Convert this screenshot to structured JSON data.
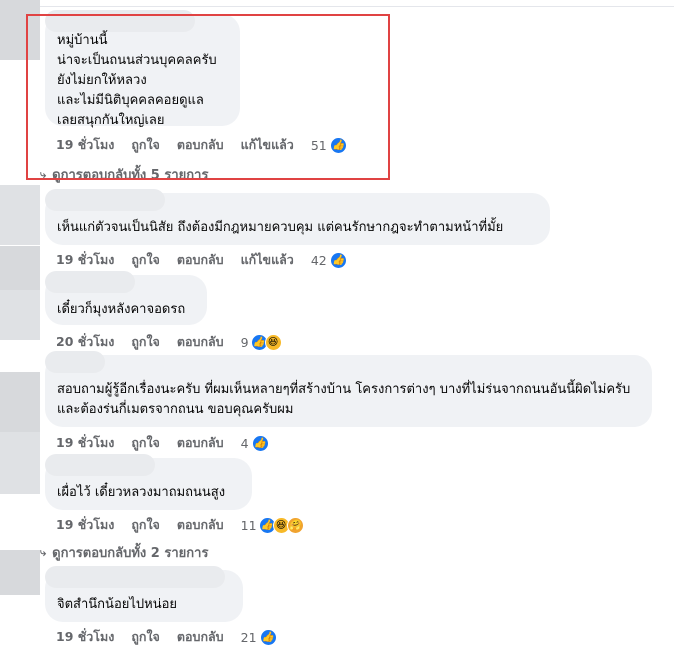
{
  "colors": {
    "like_blue": "#1877f2",
    "meta_gray": "#65676b",
    "bubble_bg": "#f0f2f5",
    "highlight_red": "#e04343"
  },
  "comments": [
    {
      "text": "หมู่บ้านนี้\nน่าจะเป็นถนนส่วนบุคคลครับ\nยังไม่ยกให้หลวง\nและไม่มีนิติบุคคลคอยดูแล\nเลยสนุกกันใหญ่เลย",
      "time": "19 ชั่วโมง",
      "like": "ถูกใจ",
      "reply": "ตอบกลับ",
      "edited": "แก้ไขแล้ว",
      "reaction_count": "51",
      "reactions": [
        "like-icon"
      ]
    },
    {
      "text": "เห็นแก่ตัวจนเป็นนิสัย ถึงต้องมีกฎหมายควบคุม แต่คนรักษากฎจะทำตามหน้าที่มั้ย",
      "time": "19 ชั่วโมง",
      "like": "ถูกใจ",
      "reply": "ตอบกลับ",
      "edited": "แก้ไขแล้ว",
      "reaction_count": "42",
      "reactions": [
        "like-icon"
      ]
    },
    {
      "text": "เดี๋ยวก็มุงหลังคาจอดรถ",
      "time": "20 ชั่วโมง",
      "like": "ถูกใจ",
      "reply": "ตอบกลับ",
      "reaction_count": "9",
      "reactions": [
        "like-icon",
        "haha-icon"
      ]
    },
    {
      "text": "สอบถามผู้รู้อีกเรื่องนะครับ ที่ผมเห็นหลายๆที่สร้างบ้าน โครงการต่างๆ บางที่ไม่ร่นจากถนนอันนี้ผิดไม่ครับ และต้องร่นกี่เมตรจากถนน ขอบคุณครับผม",
      "time": "19 ชั่วโมง",
      "like": "ถูกใจ",
      "reply": "ตอบกลับ",
      "reaction_count": "4",
      "reactions": [
        "like-icon"
      ]
    },
    {
      "text": "เผื่อไว้ เดี๋ยวหลวงมาถมถนนสูง",
      "time": "19 ชั่วโมง",
      "like": "ถูกใจ",
      "reply": "ตอบกลับ",
      "reaction_count": "11",
      "reactions": [
        "like-icon",
        "haha-icon",
        "care-icon"
      ]
    },
    {
      "text": "จิตสำนึกน้อยไปหน่อย",
      "time": "19 ชั่วโมง",
      "like": "ถูกใจ",
      "reply": "ตอบกลับ",
      "reaction_count": "21",
      "reactions": [
        "like-icon"
      ]
    }
  ],
  "view_replies": [
    {
      "label": "ดูการตอบกลับทั้ง 5 รายการ"
    },
    {
      "label": "ดูการตอบกลับทั้ง 2 รายการ"
    }
  ]
}
